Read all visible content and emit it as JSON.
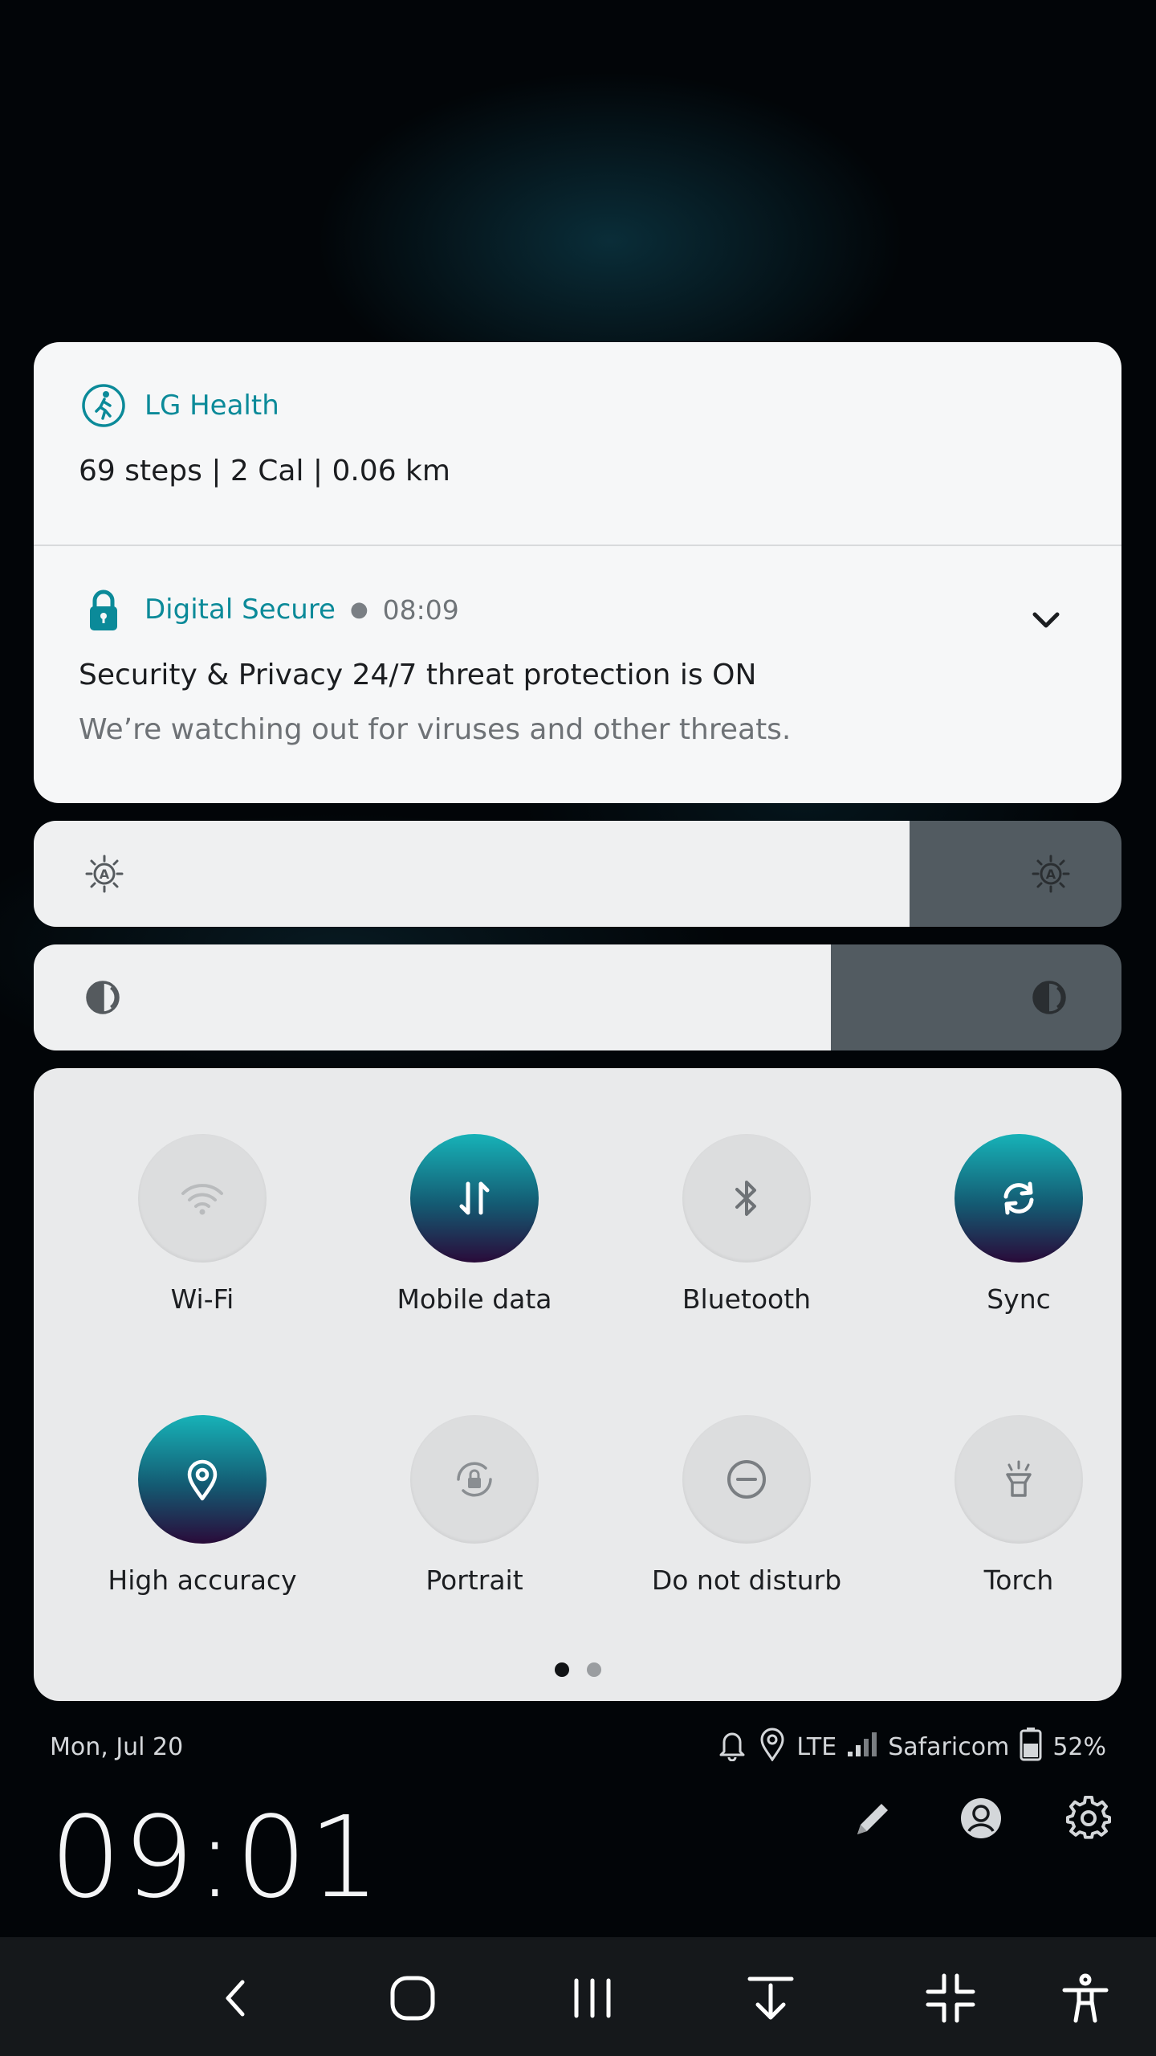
{
  "notifications": [
    {
      "app": "LG Health",
      "title": "69 steps | 2 Cal | 0.06 km",
      "icon": "walking-person-icon"
    },
    {
      "app": "Digital Secure",
      "time": "08:09",
      "title": "Security & Privacy 24/7 threat protection is ON",
      "body": "We’re watching out for viruses and other threats.",
      "icon": "padlock-icon"
    }
  ],
  "sliders": {
    "brightness": {
      "icon": "brightness-auto-icon",
      "level": 0.805
    },
    "contrast": {
      "icon": "eye-comfort-icon",
      "level": 0.733
    }
  },
  "quick_settings": [
    {
      "label": "Wi-Fi",
      "icon": "wifi-icon",
      "active": false
    },
    {
      "label": "Mobile data",
      "icon": "mobile-data-icon",
      "active": true
    },
    {
      "label": "Bluetooth",
      "icon": "bluetooth-icon",
      "active": false
    },
    {
      "label": "Sync",
      "icon": "sync-icon",
      "active": true
    },
    {
      "label": "High accuracy",
      "icon": "location-pin-icon",
      "active": true
    },
    {
      "label": "Portrait",
      "icon": "rotation-lock-icon",
      "active": false
    },
    {
      "label": "Do not disturb",
      "icon": "do-not-disturb-icon",
      "active": false
    },
    {
      "label": "Torch",
      "icon": "torch-icon",
      "active": false
    }
  ],
  "pager": {
    "current": 1,
    "total": 2
  },
  "status": {
    "date": "Mon, Jul 20",
    "network": "LTE",
    "carrier": "Safaricom",
    "battery": "52%"
  },
  "clock": "09:01",
  "colors": {
    "accent": "#0b8a99",
    "tile_on_top": "#17b3b8",
    "tile_on_bottom": "#2a0b3a"
  }
}
